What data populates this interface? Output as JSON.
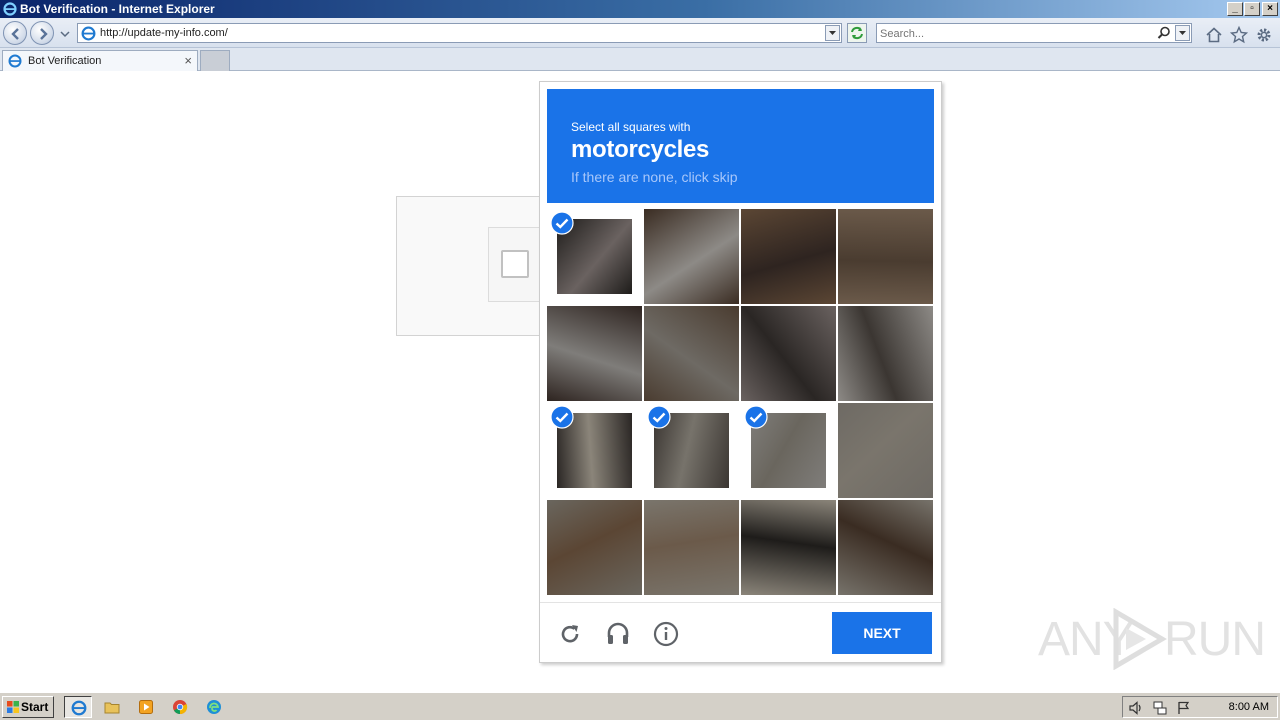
{
  "window": {
    "title": "Bot Verification - Internet Explorer"
  },
  "navbar": {
    "address": "http://update-my-info.com/",
    "search_placeholder": "Search..."
  },
  "tabs": [
    {
      "label": "Bot Verification"
    }
  ],
  "challenge": {
    "prompt": "Select all squares with",
    "target": "motorcycles",
    "hint": "If there are none, click skip",
    "next_label": "NEXT",
    "tiles": [
      {
        "row": 0,
        "col": 0,
        "selected": true
      },
      {
        "row": 0,
        "col": 1,
        "selected": false
      },
      {
        "row": 0,
        "col": 2,
        "selected": false
      },
      {
        "row": 0,
        "col": 3,
        "selected": false
      },
      {
        "row": 1,
        "col": 0,
        "selected": false
      },
      {
        "row": 1,
        "col": 1,
        "selected": false
      },
      {
        "row": 1,
        "col": 2,
        "selected": false
      },
      {
        "row": 1,
        "col": 3,
        "selected": false
      },
      {
        "row": 2,
        "col": 0,
        "selected": true
      },
      {
        "row": 2,
        "col": 1,
        "selected": true
      },
      {
        "row": 2,
        "col": 2,
        "selected": true
      },
      {
        "row": 2,
        "col": 3,
        "selected": false
      },
      {
        "row": 3,
        "col": 0,
        "selected": false
      },
      {
        "row": 3,
        "col": 1,
        "selected": false
      },
      {
        "row": 3,
        "col": 2,
        "selected": false
      },
      {
        "row": 3,
        "col": 3,
        "selected": false
      }
    ]
  },
  "icons": {
    "reload": "reload-icon",
    "audio": "headphones-icon",
    "info": "info-icon"
  },
  "colors": {
    "accent": "#1a73e8",
    "hint": "#a8c7fa"
  },
  "taskbar": {
    "start_label": "Start",
    "clock": "8:00 AM"
  },
  "watermark": {
    "left": "ANY",
    "right": "RUN"
  }
}
